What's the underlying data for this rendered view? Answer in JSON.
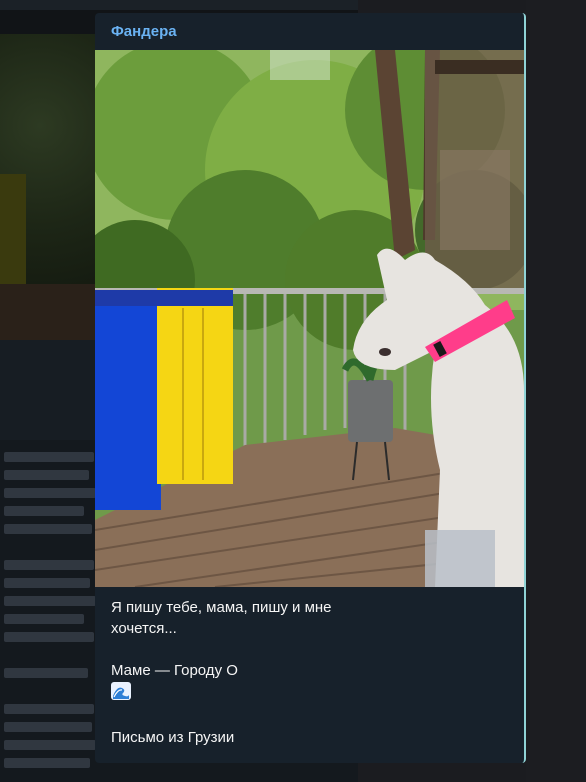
{
  "post": {
    "channel_name": "Фандера",
    "caption": {
      "line1": "Я пишу тебе, мама, пишу и мне",
      "line2": "хочется...",
      "line3": "Маме — Городу О",
      "emoji": "wave-icon",
      "line4": "Письмо из Грузии"
    },
    "photo_description_icon": "photo"
  },
  "colors": {
    "card_bg": "#17212b",
    "accent": "#6ab2f2",
    "text": "#f5f5f5",
    "flag_blue": "#1346d6",
    "flag_yellow": "#f5d614",
    "collar": "#ff3d8a"
  }
}
